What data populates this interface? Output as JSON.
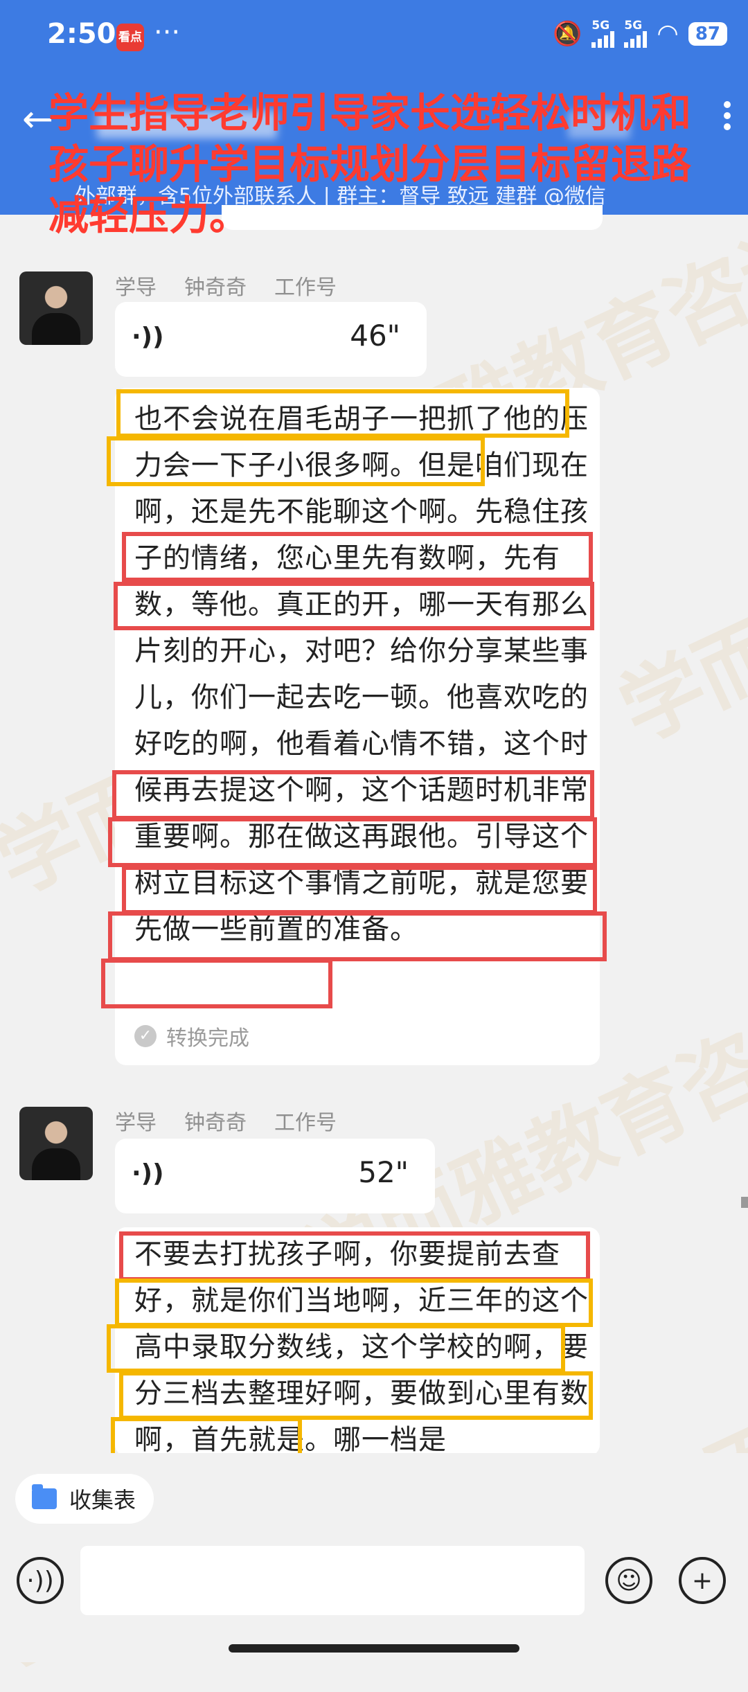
{
  "status_bar": {
    "time": "2:50",
    "app_icon_text": "看点",
    "more": "···",
    "signal1": "5G",
    "signal2": "5G",
    "battery": "87"
  },
  "header": {
    "group_info": "外部群，含5位外部联系人 | 群主：督导  致远    建群 @微信"
  },
  "overlay_caption": "学生指导老师引导家长选轻松时机和孩子聊升学目标规划分层目标留退路减轻压力。",
  "messages": [
    {
      "sender_role": "学导",
      "sender_name": "钟奇奇",
      "sender_tag": "工作号",
      "voice_duration": "46\"",
      "transcript": "也不会说在眉毛胡子一把抓了他的压力会一下子小很多啊。但是咱们现在啊，还是先不能聊这个啊。先稳住孩子的情绪，您心里先有数啊，先有数，等他。真正的开，哪一天有那么片刻的开心，对吧？给你分享某些事儿，你们一起去吃一顿。他喜欢吃的好吃的啊，他看着心情不错，这个时候再去提这个啊，这个话题时机非常重要啊。那在做这再跟他。引导这个树立目标这个事情之前呢，就是您要先做一些前置的准备。",
      "status": "转换完成"
    },
    {
      "sender_role": "学导",
      "sender_name": "钟奇奇",
      "sender_tag": "工作号",
      "voice_duration": "52\"",
      "transcript": "不要去打扰孩子啊，你要提前去查好，就是你们当地啊，近三年的这个高中录取分数线，这个学校的啊，要分三档去整理好啊，要做到心里有数啊，首先就是。哪一档是"
    }
  ],
  "watermark_text": "学而雅教育咨询",
  "bottom": {
    "collect_label": "收集表"
  },
  "colors": {
    "header_blue": "#3d7be3",
    "caption_red": "#ff3b30",
    "highlight_yellow": "#f5b700",
    "highlight_red": "#e74b4b"
  }
}
